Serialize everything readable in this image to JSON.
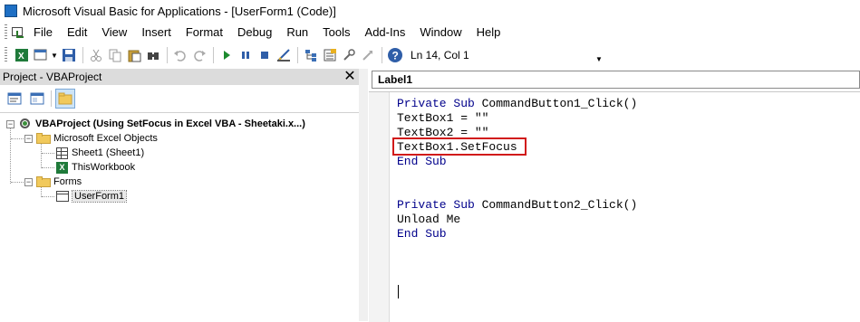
{
  "window": {
    "title": "Microsoft Visual Basic for Applications - [UserForm1 (Code)]"
  },
  "menubar": {
    "items": [
      {
        "name": "file",
        "label": "File"
      },
      {
        "name": "edit",
        "label": "Edit"
      },
      {
        "name": "view",
        "label": "View"
      },
      {
        "name": "insert",
        "label": "Insert"
      },
      {
        "name": "format",
        "label": "Format"
      },
      {
        "name": "debug",
        "label": "Debug"
      },
      {
        "name": "run",
        "label": "Run"
      },
      {
        "name": "tools",
        "label": "Tools"
      },
      {
        "name": "addins",
        "label": "Add-Ins"
      },
      {
        "name": "window",
        "label": "Window"
      },
      {
        "name": "help",
        "label": "Help"
      }
    ]
  },
  "toolbar": {
    "status": "Ln 14, Col 1"
  },
  "project": {
    "title": "Project - VBAProject",
    "tree": {
      "root": "VBAProject (Using SetFocus in Excel VBA - Sheetaki.x...)",
      "excel_objects": "Microsoft Excel Objects",
      "sheet1": "Sheet1 (Sheet1)",
      "workbook": "ThisWorkbook",
      "forms": "Forms",
      "userform": "UserForm1"
    }
  },
  "code": {
    "object_combo": "Label1",
    "lines": {
      "l1_kw": "Private Sub",
      "l1_rest": " CommandButton1_Click()",
      "l2": "TextBox1 = \"\"",
      "l3": "TextBox2 = \"\"",
      "l4": "TextBox1.SetFocus",
      "l5": "End Sub",
      "l6_kw": "Private Sub",
      "l6_rest": " CommandButton2_Click()",
      "l7": "Unload Me",
      "l8": "End Sub"
    }
  },
  "colors": {
    "keyword": "#00008b",
    "highlight": "#d11a1a"
  }
}
